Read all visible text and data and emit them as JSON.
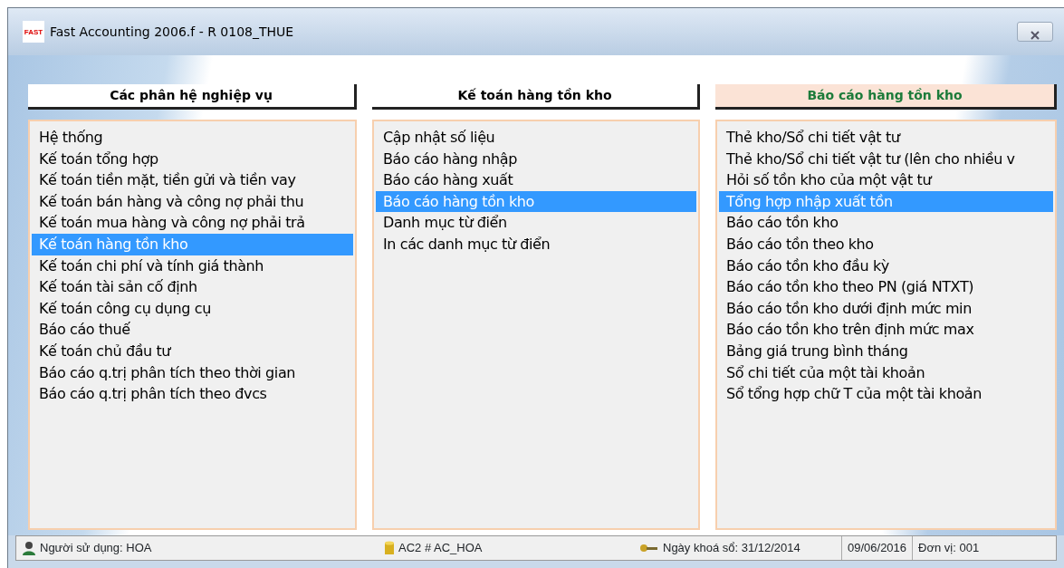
{
  "window": {
    "logo": "FAST",
    "title": "Fast Accounting 2006.f - R 0108_THUE"
  },
  "panels": [
    {
      "header": "Các phân hệ nghiệp vụ",
      "selected": false,
      "items": [
        {
          "label": "Hệ thống",
          "selected": false
        },
        {
          "label": "Kế toán tổng hợp",
          "selected": false
        },
        {
          "label": "Kế toán tiền mặt, tiền gửi và tiền vay",
          "selected": false
        },
        {
          "label": "Kế toán bán hàng và công nợ phải thu",
          "selected": false
        },
        {
          "label": "Kế toán mua hàng và công nợ phải trả",
          "selected": false
        },
        {
          "label": "Kế toán hàng tồn kho",
          "selected": true
        },
        {
          "label": "Kế toán chi phí và tính giá thành",
          "selected": false
        },
        {
          "label": "Kế toán tài sản cố định",
          "selected": false
        },
        {
          "label": "Kế toán công cụ dụng cụ",
          "selected": false
        },
        {
          "label": "Báo cáo thuế",
          "selected": false
        },
        {
          "label": "Kế toán chủ đầu tư",
          "selected": false
        },
        {
          "label": "Báo cáo q.trị phân tích theo thời gian",
          "selected": false
        },
        {
          "label": "Báo cáo q.trị phân tích theo đvcs",
          "selected": false
        }
      ]
    },
    {
      "header": "Kế toán hàng tồn kho",
      "selected": false,
      "items": [
        {
          "label": "Cập nhật số liệu",
          "selected": false
        },
        {
          "label": "Báo cáo hàng nhập",
          "selected": false
        },
        {
          "label": "Báo cáo hàng xuất",
          "selected": false
        },
        {
          "label": "Báo cáo hàng tồn kho",
          "selected": true
        },
        {
          "label": "Danh mục từ điển",
          "selected": false
        },
        {
          "label": "In các danh mục từ điển",
          "selected": false
        }
      ]
    },
    {
      "header": "Báo cáo hàng tồn kho",
      "selected": true,
      "items": [
        {
          "label": "Thẻ kho/Sổ chi tiết vật tư",
          "selected": false
        },
        {
          "label": "Thẻ kho/Sổ chi tiết vật tư (lên cho nhiều v",
          "selected": false
        },
        {
          "label": "Hỏi số tồn kho của một vật tư",
          "selected": false
        },
        {
          "label": "Tổng hợp nhập xuất tồn",
          "selected": true
        },
        {
          "label": "Báo cáo tồn kho",
          "selected": false
        },
        {
          "label": "Báo cáo tồn theo kho",
          "selected": false
        },
        {
          "label": "Báo cáo tồn kho đầu kỳ",
          "selected": false
        },
        {
          "label": "Báo cáo tồn kho theo PN (giá NTXT)",
          "selected": false
        },
        {
          "label": "Báo cáo tồn kho dưới định mức min",
          "selected": false
        },
        {
          "label": "Báo cáo tồn kho trên định mức max",
          "selected": false
        },
        {
          "label": "Bảng giá trung bình tháng",
          "selected": false
        },
        {
          "label": "Sổ chi tiết của một tài khoản",
          "selected": false
        },
        {
          "label": "Sổ tổng hợp chữ T của một tài khoản",
          "selected": false
        }
      ]
    }
  ],
  "status_bar": {
    "user": "Người sử dụng: HOA",
    "database": "AC2 # AC_HOA",
    "lock_date": "Ngày khoá sổ: 31/12/2014",
    "date": "09/06/2016",
    "unit": "Đơn vị: 001"
  }
}
